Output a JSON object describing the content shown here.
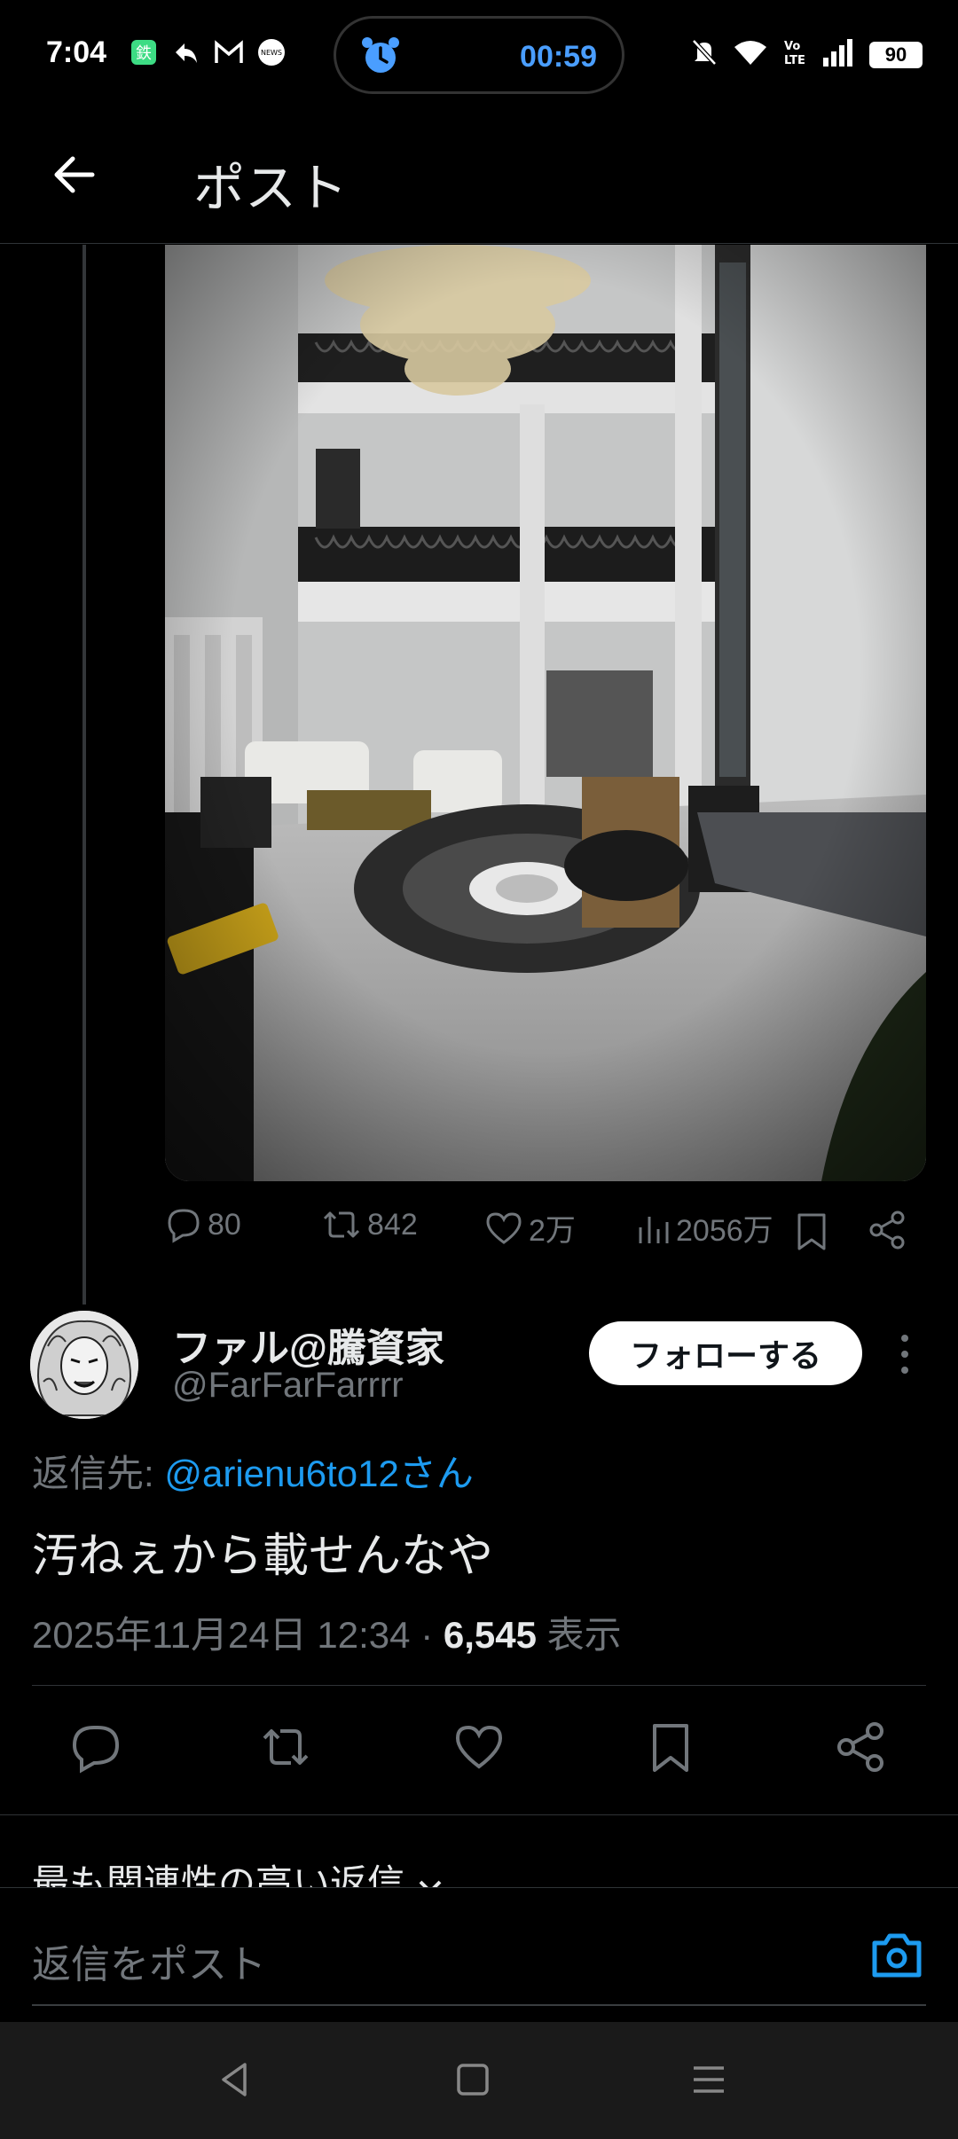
{
  "status_bar": {
    "time": "7:04",
    "timer": "00:59",
    "battery": "90"
  },
  "header": {
    "title": "ポスト"
  },
  "original_post": {
    "replies": "80",
    "reposts": "842",
    "likes": "2万",
    "views": "2056万"
  },
  "reply": {
    "author_name": "ファル@騰資家",
    "author_handle": "@FarFarFarrrr",
    "follow_label": "フォローする",
    "replying_to_label": "返信先:",
    "replying_to_mention": "@arienu6to12さん",
    "text": "汚ねぇから載せんなや",
    "datetime": "2025年11月24日 12:34",
    "separator": "·",
    "view_count": "6,545",
    "views_label": "表示"
  },
  "sort": {
    "label": "最も関連性の高い返信"
  },
  "composer": {
    "placeholder": "返信をポスト"
  },
  "colors": {
    "accent": "#1d9bf0",
    "background": "#000000",
    "muted": "#71767b"
  }
}
